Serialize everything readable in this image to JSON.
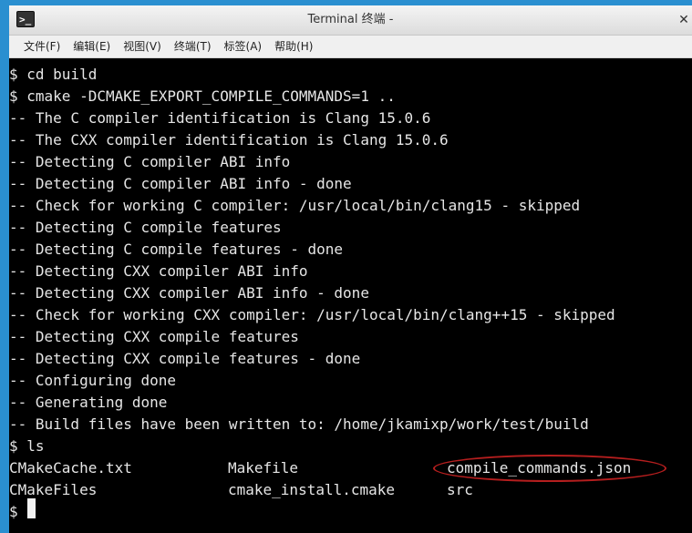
{
  "window": {
    "title": "Terminal 终端 -",
    "app_icon_glyph": ">_",
    "close_glyph": "✕"
  },
  "menu": [
    {
      "label": "文件(F)"
    },
    {
      "label": "编辑(E)"
    },
    {
      "label": "视图(V)"
    },
    {
      "label": "终端(T)"
    },
    {
      "label": "标签(A)"
    },
    {
      "label": "帮助(H)"
    }
  ],
  "terminal": {
    "lines": [
      "$ cd build",
      "$ cmake -DCMAKE_EXPORT_COMPILE_COMMANDS=1 ..",
      "-- The C compiler identification is Clang 15.0.6",
      "-- The CXX compiler identification is Clang 15.0.6",
      "-- Detecting C compiler ABI info",
      "-- Detecting C compiler ABI info - done",
      "-- Check for working C compiler: /usr/local/bin/clang15 - skipped",
      "-- Detecting C compile features",
      "-- Detecting C compile features - done",
      "-- Detecting CXX compiler ABI info",
      "-- Detecting CXX compiler ABI info - done",
      "-- Check for working CXX compiler: /usr/local/bin/clang++15 - skipped",
      "-- Detecting CXX compile features",
      "-- Detecting CXX compile features - done",
      "-- Configuring done",
      "-- Generating done",
      "-- Build files have been written to: /home/jkamixp/work/test/build",
      "$ ls"
    ],
    "ls_rows": [
      [
        "CMakeCache.txt",
        "Makefile",
        "compile_commands.json"
      ],
      [
        "CMakeFiles",
        "cmake_install.cmake",
        "src"
      ]
    ],
    "prompt": "$",
    "highlight_color": "#b51e1e"
  }
}
